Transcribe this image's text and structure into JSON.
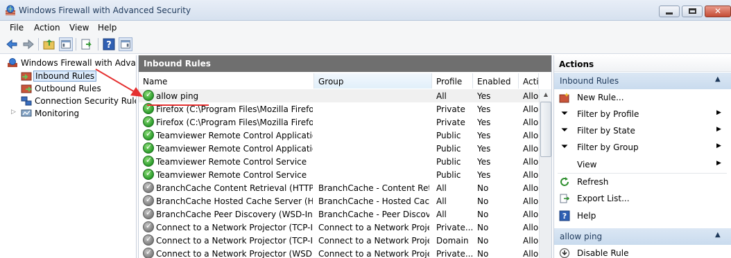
{
  "window": {
    "title": "Windows Firewall with Advanced Security"
  },
  "menu": [
    "File",
    "Action",
    "View",
    "Help"
  ],
  "tree": {
    "root": "Windows Firewall with Advanced Security",
    "items": [
      "Inbound Rules",
      "Outbound Rules",
      "Connection Security Rules",
      "Monitoring"
    ]
  },
  "center": {
    "header": "Inbound Rules",
    "columns": [
      "Name",
      "Group",
      "Profile",
      "Enabled",
      "Acti"
    ],
    "rows": [
      {
        "name": "allow ping",
        "group": "",
        "profile": "All",
        "enabled": "Yes",
        "action": "Allo",
        "on": true
      },
      {
        "name": "Firefox (C:\\Program Files\\Mozilla Firefox)",
        "group": "",
        "profile": "Private",
        "enabled": "Yes",
        "action": "Allo",
        "on": true
      },
      {
        "name": "Firefox (C:\\Program Files\\Mozilla Firefox)",
        "group": "",
        "profile": "Private",
        "enabled": "Yes",
        "action": "Allo",
        "on": true
      },
      {
        "name": "Teamviewer Remote Control Application",
        "group": "",
        "profile": "Public",
        "enabled": "Yes",
        "action": "Allo",
        "on": true
      },
      {
        "name": "Teamviewer Remote Control Application",
        "group": "",
        "profile": "Public",
        "enabled": "Yes",
        "action": "Allo",
        "on": true
      },
      {
        "name": "Teamviewer Remote Control Service",
        "group": "",
        "profile": "Public",
        "enabled": "Yes",
        "action": "Allo",
        "on": true
      },
      {
        "name": "Teamviewer Remote Control Service",
        "group": "",
        "profile": "Public",
        "enabled": "Yes",
        "action": "Allo",
        "on": true
      },
      {
        "name": "BranchCache Content Retrieval (HTTP-In)",
        "group": "BranchCache - Content Retr...",
        "profile": "All",
        "enabled": "No",
        "action": "Allo",
        "on": false
      },
      {
        "name": "BranchCache Hosted Cache Server (HTT...",
        "group": "BranchCache - Hosted Cach...",
        "profile": "All",
        "enabled": "No",
        "action": "Allo",
        "on": false
      },
      {
        "name": "BranchCache Peer Discovery (WSD-In)",
        "group": "BranchCache - Peer Discove...",
        "profile": "All",
        "enabled": "No",
        "action": "Allo",
        "on": false
      },
      {
        "name": "Connect to a Network Projector (TCP-In)",
        "group": "Connect to a Network Proje...",
        "profile": "Private...",
        "enabled": "No",
        "action": "Allo",
        "on": false
      },
      {
        "name": "Connect to a Network Projector (TCP-In)",
        "group": "Connect to a Network Proje...",
        "profile": "Domain",
        "enabled": "No",
        "action": "Allo",
        "on": false
      },
      {
        "name": "Connect to a Network Projector (WSD Ev...",
        "group": "Connect to a Network Proje...",
        "profile": "Private...",
        "enabled": "No",
        "action": "Allo",
        "on": false
      }
    ]
  },
  "actions": {
    "title": "Actions",
    "section1": "Inbound Rules",
    "items": [
      "New Rule...",
      "Filter by Profile",
      "Filter by State",
      "Filter by Group",
      "View",
      "Refresh",
      "Export List...",
      "Help"
    ],
    "section2": "allow ping",
    "items2": [
      "Disable Rule"
    ]
  },
  "colors": {
    "annotation": "#e53030",
    "header_gray": "#6f6f6f",
    "section_blue": "#c9dbee"
  }
}
